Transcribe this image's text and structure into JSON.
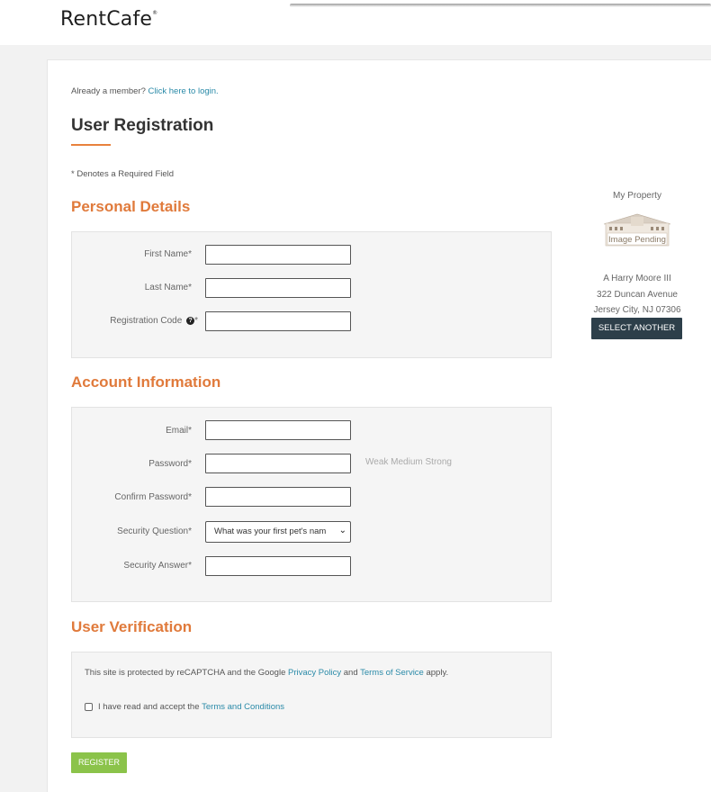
{
  "header": {
    "logo": "RentCafe",
    "logo_mark": "®"
  },
  "login_prompt": {
    "text": "Already a member?",
    "link": "Click here to login."
  },
  "page_title": "User Registration",
  "required_note": "* Denotes a Required Field",
  "personal": {
    "heading": "Personal Details",
    "first_name_label": "First Name*",
    "last_name_label": "Last Name*",
    "reg_code_label": "Registration Code",
    "reg_code_help": "?",
    "reg_code_req": "*"
  },
  "account": {
    "heading": "Account Information",
    "email_label": "Email*",
    "password_label": "Password*",
    "strength": "Weak  Medium  Strong",
    "confirm_label": "Confirm Password*",
    "question_label": "Security Question*",
    "question_value": "What was your first pet's nam",
    "answer_label": "Security Answer*"
  },
  "verification": {
    "heading": "User Verification",
    "recaptcha_prefix": "This site is protected by reCAPTCHA and the Google ",
    "privacy_link": "Privacy Policy",
    "and": " and ",
    "terms_link": "Terms of Service",
    "apply": " apply.",
    "accept_prefix": "I have read and accept the ",
    "conditions_link": "Terms and Conditions"
  },
  "register_label": "REGISTER",
  "property": {
    "heading": "My Property",
    "image_text": "Image Pending",
    "line1": "A Harry Moore III",
    "line2": "322 Duncan Avenue",
    "line3": "Jersey City, NJ 07306",
    "select_label": "SELECT ANOTHER"
  },
  "colors": {
    "accent": "#e07a3b",
    "link": "#2a8aa8",
    "register": "#8bc34a",
    "select_btn": "#2d3f4a"
  }
}
